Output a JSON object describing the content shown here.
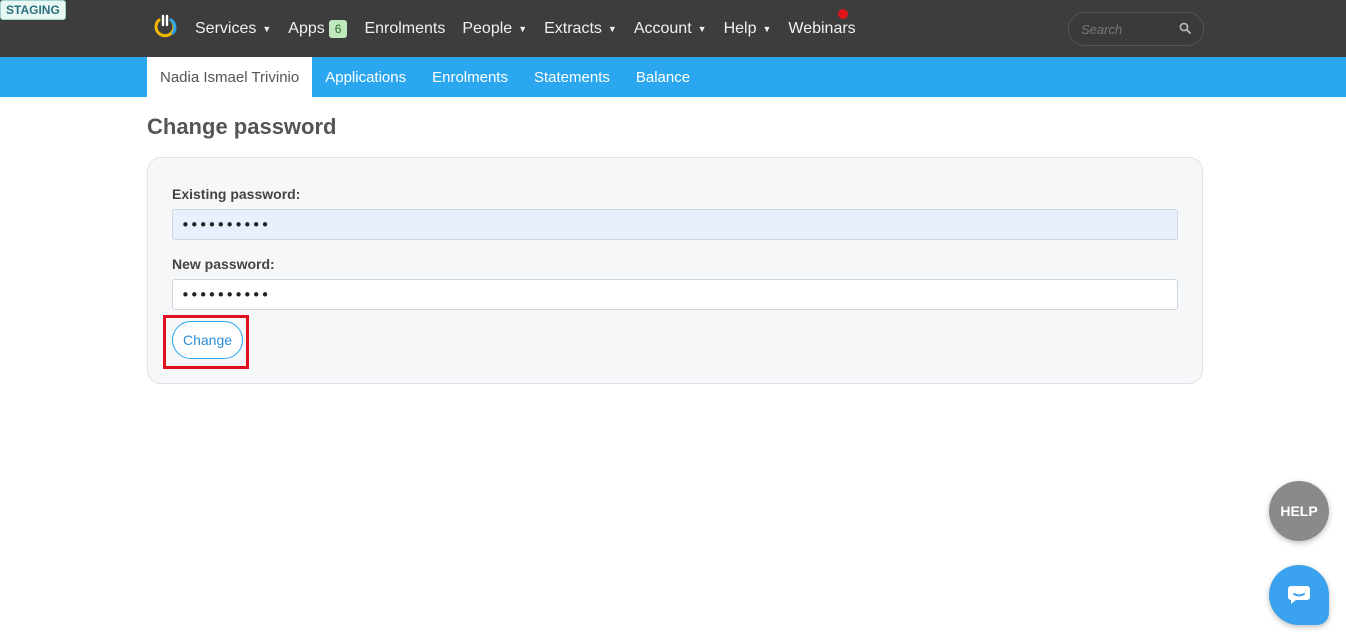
{
  "environment_badge": "STAGING",
  "topnav": {
    "items": [
      {
        "label": "Services",
        "has_caret": true
      },
      {
        "label": "Apps",
        "badge": "6"
      },
      {
        "label": "Enrolments"
      },
      {
        "label": "People",
        "has_caret": true
      },
      {
        "label": "Extracts",
        "has_caret": true
      },
      {
        "label": "Account",
        "has_caret": true
      },
      {
        "label": "Help",
        "has_caret": true
      },
      {
        "label": "Webinars",
        "has_notification": true
      }
    ],
    "caret": "▼",
    "search_placeholder": "Search",
    "search_icon": "search-icon",
    "logo_icon": "power-logo-icon"
  },
  "subnav": {
    "tabs": [
      {
        "label": "Nadia Ismael Trivinio",
        "active": true
      },
      {
        "label": "Applications"
      },
      {
        "label": "Enrolments"
      },
      {
        "label": "Statements"
      },
      {
        "label": "Balance"
      }
    ]
  },
  "page": {
    "title": "Change password",
    "form": {
      "existing_label": "Existing password:",
      "existing_value": "••••••••••",
      "new_label": "New password:",
      "new_value": "••••••••••",
      "submit_label": "Change"
    }
  },
  "floating": {
    "help_label": "HELP",
    "chat_icon": "chat-bubble-icon"
  },
  "colors": {
    "topbar": "#3d3d3d",
    "subbar": "#2aa7ee",
    "highlight": "#e01020",
    "notification": "#e0151b"
  }
}
